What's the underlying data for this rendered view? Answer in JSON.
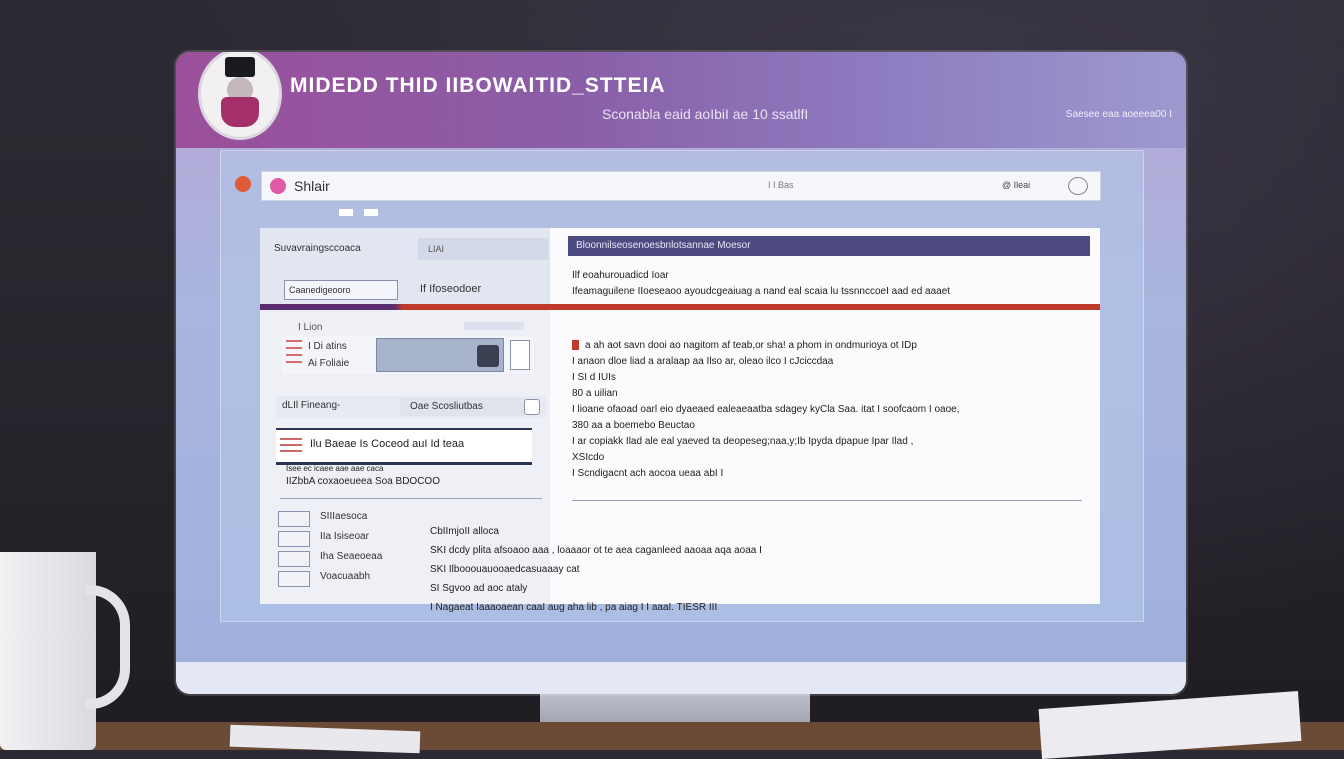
{
  "app": {
    "title": "MIDEDD THID IIBOWAITID_STTEIA",
    "subtitle": "Sconabla eaid aoIbiI ae 10 ssatlfI",
    "meta": "Saesee eaa aoeeea00 I"
  },
  "browser": {
    "address": "Shlair",
    "address_mid": "I I Bas",
    "address_right": "@ Ileai"
  },
  "sidebar": {
    "search_label": "Suvavraingsccoaca",
    "tag_label": "LIAI",
    "field_left": "Caanedigeooro",
    "field_right": "If Ifoseodoer",
    "section_heading": "I Lion",
    "card_lines": [
      "I Di atins",
      "Ai Foliaie"
    ],
    "row_left": "dLIl Fineang-",
    "row_right": "Oae Scosliutbas",
    "band_text": "Ilu Baeae Is Coceod auI Id teaa",
    "desc_small": "Isee ec icaee aae aae caca",
    "desc_line": "IIZbbA coxaoeueea Soa BDOCOO",
    "list": [
      "SIIIaesoca",
      "IIa Isiseoar",
      "Iha Seaeoeaa",
      "Voacuaabh"
    ]
  },
  "panel": {
    "header": "Bloonnilseosenoesbnlotsannae Moesor",
    "line1": "Ilf eoahurouadicd Ioar",
    "line2": "Ifeamaguilene IIoeseaoo ayoudcgeaiuag a nand eal scaia lu tssnnccoeI aad ed aaaet",
    "body": [
      "a ah aot savn dooi ao nagitom af teab,or sha! a phom in ondmurioya ot IDp",
      "I anaon dloe liad a aralaap aa Ilso ar,  oleao ilco I cJciccdaa",
      "I SI d IUIs",
      "80 a uilian",
      "I lioane ofaoad oarl eio dyaeaed ealeaeaatba sdagey kyCla Saa. itat I soofcaom I oaoe,",
      "380 aa a boemebo Beuctao",
      "I ar copiakk Ilad ale eal yaeved ta deopeseg;naa,y;Ib Ipyda dpapue Ipar Ilad ,",
      "XSIcdo",
      "I Scndigacnt ach aocoa ueaa abI I"
    ],
    "footer": [
      "CbIImjoII alloca",
      "SKI dcdy plita afsoaoo aaa , loaaaor ot te aea caganleed aaoaa aqa aoaa I",
      "SKI Ilbooouauooaedcasuaaay cat",
      "SI Sgvoo ad aoc ataly",
      "I Nagaeat Iaaaoaean caaI aug aha lib , pa aiag I I aaaI. TIESR III"
    ]
  },
  "colors": {
    "title_bar": "#9b4f9a",
    "panel_header": "#4c4a80",
    "accent_red": "#c0392b",
    "accent_pink": "#e05aa8"
  }
}
